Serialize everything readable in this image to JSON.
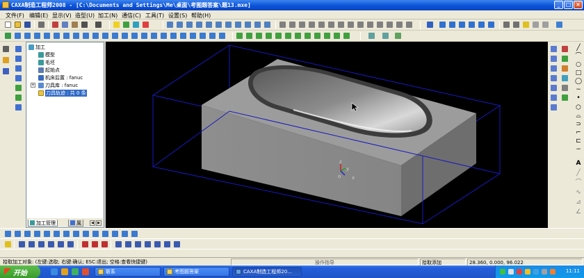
{
  "window": {
    "title": "CAXA制造工程师2008  - [C:\\Documents and Settings\\Me\\桌面\\考图题答案\\题13.mxe]",
    "minimize": "_",
    "maximize": "□",
    "close": "×"
  },
  "menu": [
    "文件(F)",
    "编辑(E)",
    "显示(V)",
    "造型(U)",
    "加工(N)",
    "通信(C)",
    "工具(T)",
    "设置(S)",
    "帮助(H)"
  ],
  "tree": {
    "root": "加工",
    "items": [
      {
        "label": "模型",
        "icon": "model-icon"
      },
      {
        "label": "毛坯",
        "icon": "blank-stock-icon"
      },
      {
        "label": "起始点",
        "icon": "start-point-icon"
      },
      {
        "label": "机床后置 : fanuc",
        "icon": "machine-post-icon"
      },
      {
        "label": "刀具库 : fanuc",
        "icon": "tool-library-icon"
      },
      {
        "label": "刀具轨迹 : 共 0 条",
        "icon": "tool-path-folder-icon"
      }
    ],
    "tabs": [
      "加工管理",
      "属"
    ]
  },
  "viewport": {
    "axis_labels": {
      "z": "z",
      "y": "y",
      "x": "x",
      "origin": "o"
    },
    "cursor": "mouse-pointer-icon"
  },
  "status": {
    "prompt": "拾取加工对象:  (左键:选取; 右键:确认; ESC:退出; 空格:查看快捷键)",
    "center": "操作指导",
    "mode": "拾取添加",
    "coordinates": "28.360, 0.000, 96.022"
  },
  "taskbar": {
    "start": "开始",
    "tasks": [
      {
        "label": "联系"
      },
      {
        "label": "考图题答案"
      },
      {
        "label": "CAXA制造工程师20..."
      }
    ],
    "clock": "11:11"
  },
  "colors": {
    "titlebar": "#0a52d8",
    "viewport_bg": "#000000",
    "bounding_box": "#1818c0",
    "part_top": "#9c9c9c",
    "part_front": "#8a8a8a",
    "part_right": "#6e6e6e",
    "selection": "#316ac5"
  }
}
